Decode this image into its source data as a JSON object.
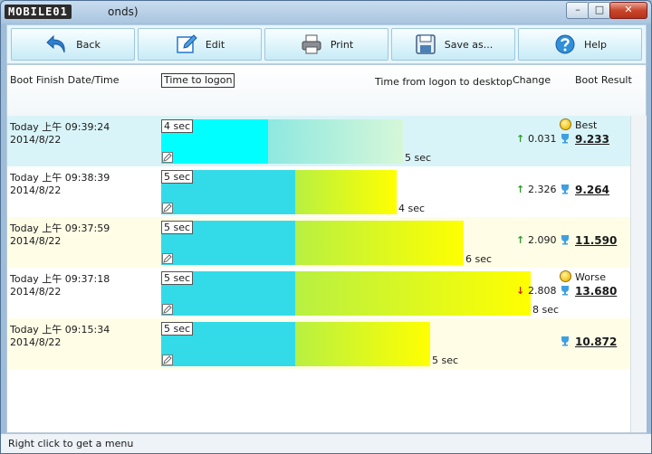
{
  "window": {
    "logo_text": "MOBILE01",
    "title_fragment": "onds)",
    "controls": {
      "minimize": "–",
      "maximize": "□",
      "close": "✕"
    }
  },
  "toolbar": {
    "back": "Back",
    "edit": "Edit",
    "print": "Print",
    "save": "Save as...",
    "help": "Help"
  },
  "columns": {
    "boot_finish": "Boot Finish Date/Time",
    "time_to_logon": "Time to logon",
    "logon_to_desktop": "Time from logon to desktop",
    "change": "Change",
    "boot_result": "Boot Result"
  },
  "rows": [
    {
      "time": "Today  上午  09:39:24",
      "date": "2014/8/22",
      "logon": "4 sec",
      "desktop": "5 sec",
      "logon_sec": 4,
      "desktop_sec": 5,
      "change": "0.031",
      "direction": "up",
      "status": "Best",
      "status_icon": "happy-face-icon",
      "score": "9.233"
    },
    {
      "time": "Today  上午  09:38:39",
      "date": "2014/8/22",
      "logon": "5 sec",
      "desktop": "4 sec",
      "logon_sec": 5,
      "desktop_sec": 4,
      "change": "2.326",
      "direction": "up",
      "status": "",
      "status_icon": "",
      "score": "9.264"
    },
    {
      "time": "Today  上午  09:37:59",
      "date": "2014/8/22",
      "logon": "5 sec",
      "desktop": "6 sec",
      "logon_sec": 5,
      "desktop_sec": 6,
      "change": "2.090",
      "direction": "up",
      "status": "",
      "status_icon": "",
      "score": "11.590"
    },
    {
      "time": "Today  上午  09:37:18",
      "date": "2014/8/22",
      "logon": "5 sec",
      "desktop": "8 sec",
      "logon_sec": 5,
      "desktop_sec": 8,
      "change": "2.808",
      "direction": "down",
      "status": "Worse",
      "status_icon": "sad-face-icon",
      "score": "13.680"
    },
    {
      "time": "Today  上午  09:15:34",
      "date": "2014/8/22",
      "logon": "5 sec",
      "desktop": "5 sec",
      "logon_sec": 5,
      "desktop_sec": 5,
      "change": "",
      "direction": "",
      "status": "",
      "status_icon": "",
      "score": "10.872"
    }
  ],
  "statusbar": {
    "hint": "Right click to get a menu"
  },
  "colors": {
    "logon_bar": "#33dbe8",
    "best_logon_bar": "#00ffff",
    "desktop_start": "#b8f042",
    "desktop_end": "#ffff00",
    "up_arrow": "#2e9a2e",
    "down_arrow": "#d02020"
  }
}
